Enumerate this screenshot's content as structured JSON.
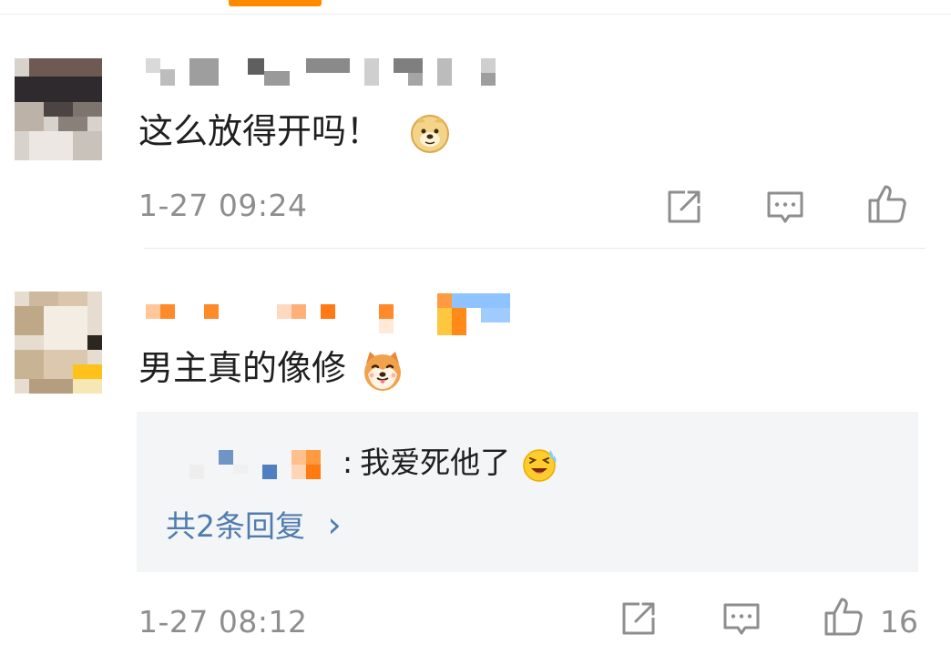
{
  "comments": [
    {
      "text": "这么放得开吗！",
      "emoji_icon": "doge-icon",
      "time": "1-27 09:24",
      "like_count": ""
    },
    {
      "text": "男主真的像修",
      "emoji_icon": "shiba-dog-icon",
      "time": "1-27 08:12",
      "like_count": "16",
      "reply": {
        "separator": ":",
        "text": "我爱死他了",
        "emoji_icon": "crying-laugh-icon",
        "more_label": "共2条回复",
        "more_chevron": "›"
      }
    }
  ],
  "colors": {
    "accent": "#ff8a00",
    "link": "#4f7cae",
    "meta_gray": "#8e8e8e",
    "text": "#1f1f1f",
    "reply_bg": "#f4f5f7"
  }
}
